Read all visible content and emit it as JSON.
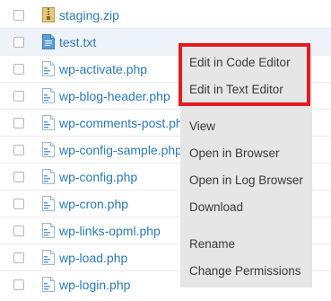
{
  "files": [
    {
      "name": "staging.zip",
      "type": "zip"
    },
    {
      "name": "test.txt",
      "type": "text"
    },
    {
      "name": "wp-activate.php",
      "type": "php"
    },
    {
      "name": "wp-blog-header.php",
      "type": "php"
    },
    {
      "name": "wp-comments-post.php",
      "type": "php"
    },
    {
      "name": "wp-config-sample.php",
      "type": "php"
    },
    {
      "name": "wp-config.php",
      "type": "php"
    },
    {
      "name": "wp-cron.php",
      "type": "php"
    },
    {
      "name": "wp-links-opml.php",
      "type": "php"
    },
    {
      "name": "wp-load.php",
      "type": "php"
    },
    {
      "name": "wp-login.php",
      "type": "php"
    }
  ],
  "selected_file": "test.txt",
  "context_menu": {
    "items": [
      "Edit in Code Editor",
      "Edit in Text Editor",
      "View",
      "Open in Browser",
      "Open in Log Browser",
      "Download",
      "Rename",
      "Change Permissions"
    ]
  },
  "colors": {
    "link": "#2a7ab7",
    "menu_bg": "#e6e6e6",
    "highlight": "#e31b23"
  }
}
